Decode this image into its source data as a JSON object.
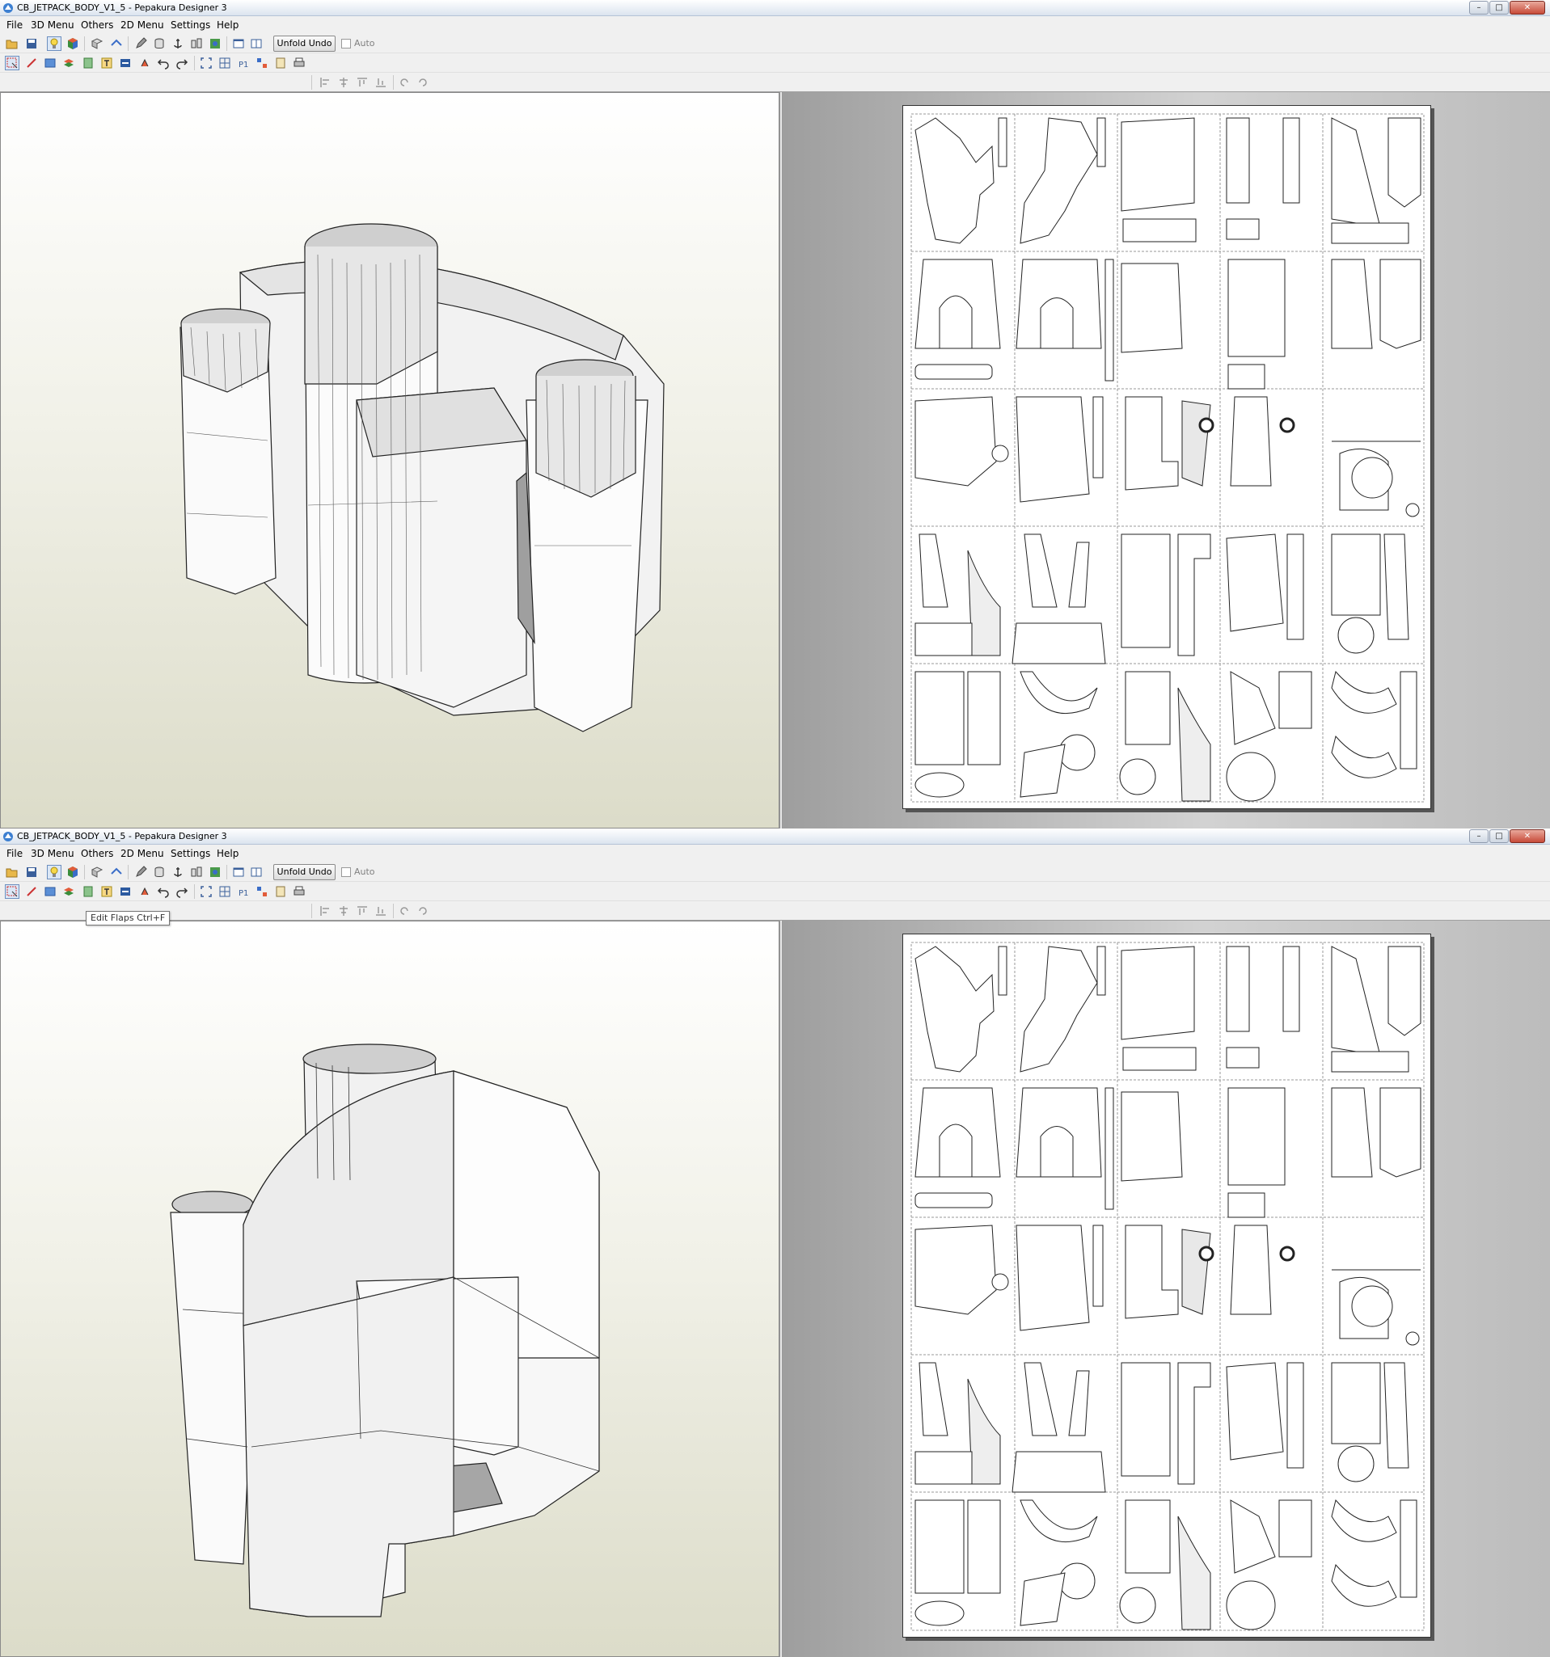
{
  "app": {
    "title": "CB_JETPACK_BODY_V1_5 - Pepakura Designer 3",
    "window_controls": {
      "minimize": "–",
      "maximize": "□",
      "close": "✕"
    }
  },
  "menu": [
    "File",
    "3D Menu",
    "Others",
    "2D Menu",
    "Settings",
    "Help"
  ],
  "toolbar": {
    "unfold_undo_label": "Unfold Undo",
    "auto_label": "Auto",
    "auto_checked": false,
    "row1_icons": [
      "open-icon",
      "save-icon",
      "light-icon",
      "texture-icon",
      "unfold-icon",
      "join-icon",
      "cylinder-icon",
      "anchor-icon",
      "split-icon",
      "flip-icon",
      "single-view-icon",
      "dual-view-icon"
    ],
    "row2_icons": [
      "select-icon",
      "edge-icon",
      "fill-icon",
      "layers-icon",
      "number-icon",
      "text-icon",
      "image-icon",
      "rotate-icon",
      "undo-icon",
      "redo-icon",
      "fit-icon",
      "grid-icon",
      "page-number-icon",
      "parts-icon",
      "calc-icon",
      "print-icon"
    ],
    "row3_icons": [
      "align-left-icon",
      "align-center-icon",
      "align-top-icon",
      "align-bottom-icon",
      "rotate-90-left-icon",
      "rotate-90-right-icon"
    ]
  },
  "tooltip": "Edit Flaps Ctrl+F",
  "colors": {
    "accent_active": "#dbe7f6",
    "background_3d_bottom": "#dcdcc9",
    "pane2d_background": "#bcbcbc"
  }
}
